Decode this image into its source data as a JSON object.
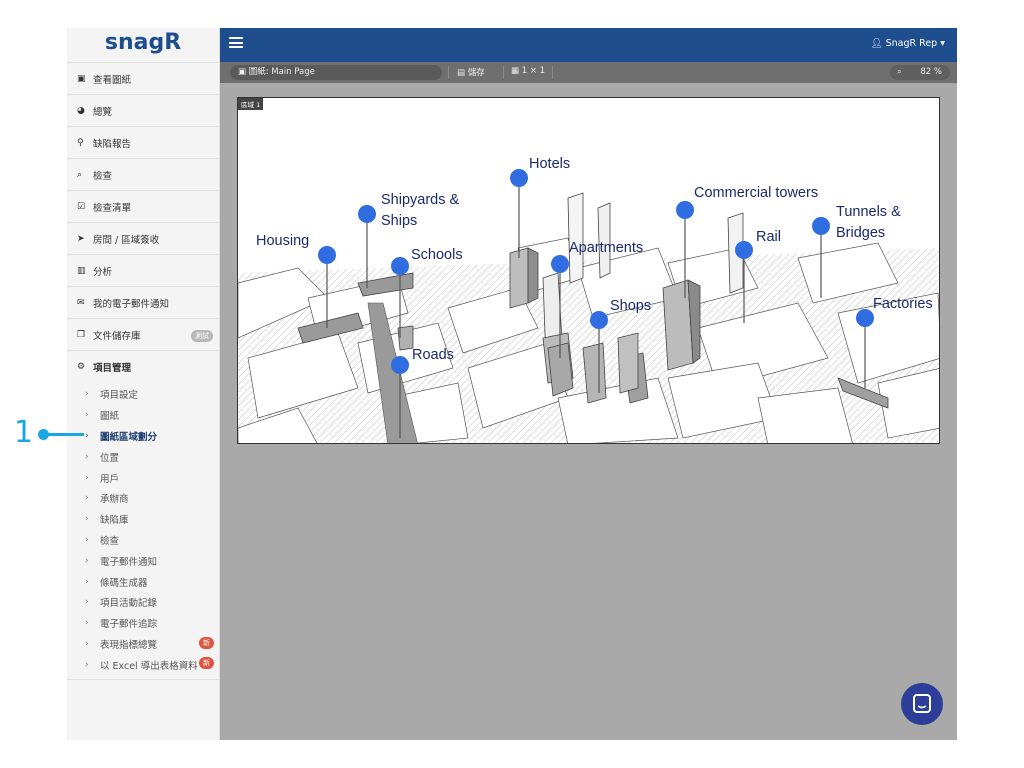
{
  "app": {
    "logo": "snagR"
  },
  "sidebar": {
    "items": [
      {
        "icon": "image-icon",
        "glyph": "▣",
        "label": "查看圖紙"
      },
      {
        "icon": "dashboard-icon",
        "glyph": "◕",
        "label": "總覽"
      },
      {
        "icon": "map-pin-icon",
        "glyph": "⚲",
        "label": "缺陷報告"
      },
      {
        "icon": "search-icon",
        "glyph": "⌕",
        "label": "檢查"
      },
      {
        "icon": "checklist-icon",
        "glyph": "☑",
        "label": "檢查清單"
      },
      {
        "icon": "location-arrow-icon",
        "glyph": "➤",
        "label": "房間 / 區域簽收"
      },
      {
        "icon": "bar-chart-icon",
        "glyph": "▥",
        "label": "分析"
      },
      {
        "icon": "envelope-icon",
        "glyph": "✉",
        "label": "我的電子郵件通知"
      },
      {
        "icon": "copy-icon",
        "glyph": "❐",
        "label": "文件儲存庫",
        "badge": "測試"
      }
    ],
    "section": {
      "icon": "cogs-icon",
      "glyph": "⚙",
      "label": "項目管理"
    },
    "submenu": [
      {
        "label": "項目設定"
      },
      {
        "label": "圖紙"
      },
      {
        "label": "圖紙區域劃分",
        "active": true
      },
      {
        "label": "位置"
      },
      {
        "label": "用戶"
      },
      {
        "label": "承辦商"
      },
      {
        "label": "缺陷庫"
      },
      {
        "label": "檢查"
      },
      {
        "label": "電子郵件通知"
      },
      {
        "label": "條碼生成器"
      },
      {
        "label": "項目活動記錄"
      },
      {
        "label": "電子郵件追踪"
      },
      {
        "label": "表現指標總覽",
        "badge": "新"
      },
      {
        "label": "以 Excel 導出表格資料",
        "badge": "新"
      }
    ]
  },
  "topbar": {
    "user": "SnagR Rep ▾"
  },
  "toolbar": {
    "page_label": "圖紙: Main Page",
    "save_label": "儲存",
    "grid_label": "1 × 1",
    "zoom_value": "82 %"
  },
  "drawing": {
    "zone_label": "區域 1",
    "labels": {
      "hotels": "Hotels",
      "shipyards": "Shipyards &",
      "ships": "Ships",
      "housing": "Housing",
      "schools": "Schools",
      "apartments": "Apartments",
      "commercial": "Commercial towers",
      "rail": "Rail",
      "tunnels": "Tunnels &",
      "bridges": "Bridges",
      "shops": "Shops",
      "factories": "Factories",
      "roads": "Roads"
    }
  },
  "callout": {
    "number": "1"
  },
  "colors": {
    "topbar": "#1f4e8e",
    "pin": "#2f6de0",
    "label": "#1a2a6c",
    "callout": "#1aa7e0"
  }
}
